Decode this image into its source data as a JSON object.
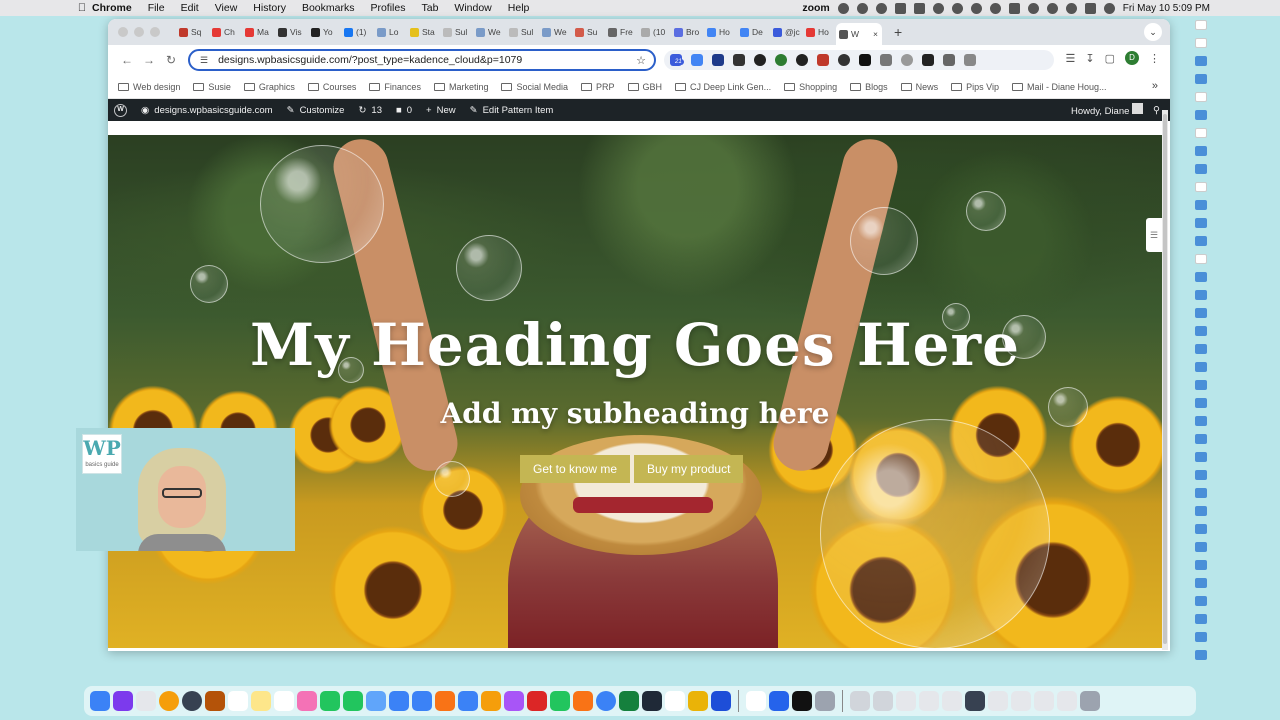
{
  "menubar": {
    "app": "Chrome",
    "items": [
      "File",
      "Edit",
      "View",
      "History",
      "Bookmarks",
      "Profiles",
      "Tab",
      "Window",
      "Help"
    ],
    "zoom_label": "zoom",
    "datetime": "Fri May 10  5:09 PM"
  },
  "tabs": [
    {
      "label": "Sq",
      "color": "#c0392b"
    },
    {
      "label": "Ch",
      "color": "#e53935"
    },
    {
      "label": "Ma",
      "color": "#e53935"
    },
    {
      "label": "Vis",
      "color": "#333333"
    },
    {
      "label": "Yo",
      "color": "#222222"
    },
    {
      "label": "(1)",
      "color": "#1877f2"
    },
    {
      "label": "Lo",
      "color": "#7a9bc8"
    },
    {
      "label": "Sta",
      "color": "#e5c01b"
    },
    {
      "label": "Sul",
      "color": "#bbbbbb"
    },
    {
      "label": "We",
      "color": "#7a9bc8"
    },
    {
      "label": "Sul",
      "color": "#bbbbbb"
    },
    {
      "label": "We",
      "color": "#7a9bc8"
    },
    {
      "label": "Su",
      "color": "#d35b4a"
    },
    {
      "label": "Fre",
      "color": "#666666"
    },
    {
      "label": "(10",
      "color": "#aaaaaa"
    },
    {
      "label": "Bro",
      "color": "#5b6ee1"
    },
    {
      "label": "Ho",
      "color": "#4285f4"
    },
    {
      "label": "De",
      "color": "#4285f4"
    },
    {
      "label": "@jc",
      "color": "#3b5bdb"
    },
    {
      "label": "Ho",
      "color": "#e53935"
    }
  ],
  "active_tab": {
    "label": "W",
    "close": "×"
  },
  "new_tab": "+",
  "address": {
    "url": "designs.wpbasicsguide.com/?post_type=kadence_cloud&p=1079"
  },
  "extension_badge": "21",
  "profile_initial": "D",
  "bookmarks": [
    "Web design",
    "Susie",
    "Graphics",
    "Courses",
    "Finances",
    "Marketing",
    "Social Media",
    "PRP",
    "GBH",
    "CJ Deep Link Gen...",
    "Shopping",
    "Blogs",
    "News",
    "Pips Vip",
    "Mail - Diane Houg..."
  ],
  "bookmarks_more": "»",
  "wp_admin_bar": {
    "site": "designs.wpbasicsguide.com",
    "customize": "Customize",
    "updates": "13",
    "comments": "0",
    "new": "New",
    "edit": "Edit Pattern Item",
    "howdy": "Howdy, Diane"
  },
  "hero": {
    "heading": "My Heading Goes Here",
    "subheading": "Add my subheading here",
    "button_1": "Get to know me",
    "button_2": "Buy my product",
    "button_color": "#c4b653"
  },
  "webcam_logo": {
    "mark": "WP",
    "tagline": "basics guide"
  }
}
